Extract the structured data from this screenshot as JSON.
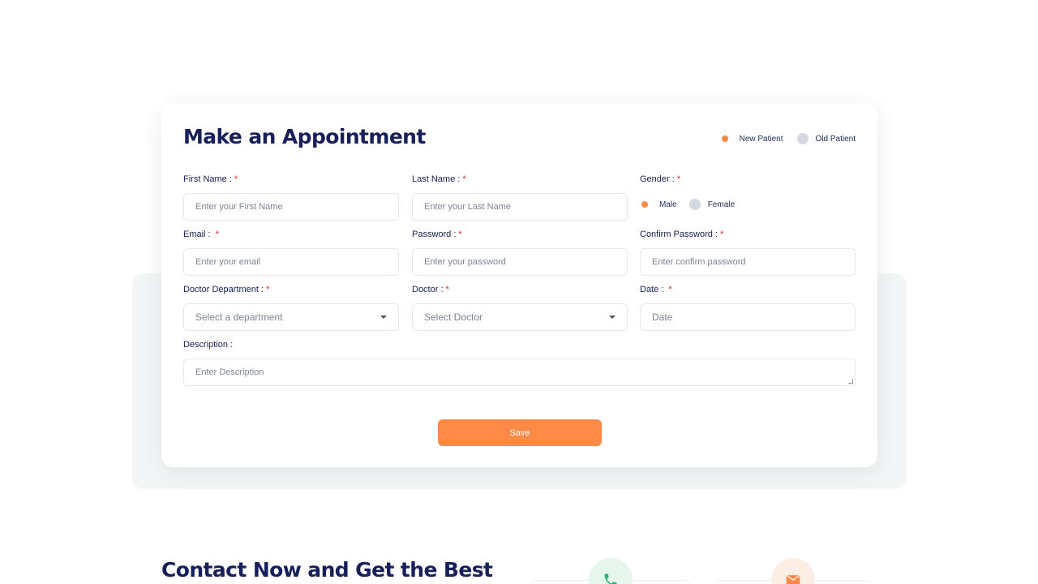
{
  "form": {
    "title": "Make an Appointment",
    "patient_type": {
      "options": [
        "New Patient",
        "Old Patient"
      ],
      "selected": "New Patient"
    },
    "first_name": {
      "label": "First Name :",
      "required": "*",
      "placeholder": "Enter your First Name"
    },
    "last_name": {
      "label": "Last Name :",
      "required": "*",
      "placeholder": "Enter your Last Name"
    },
    "gender": {
      "label": "Gender :",
      "required": "*",
      "options": [
        "Male",
        "Female"
      ],
      "selected": "Male"
    },
    "email": {
      "label": "Email :",
      "required": "*",
      "placeholder": "Enter your email"
    },
    "password": {
      "label": "Password :",
      "required": "*",
      "placeholder": "Enter your password"
    },
    "confirm_password": {
      "label": "Confirm Password :",
      "required": "*",
      "placeholder": "Enter confirm password"
    },
    "department": {
      "label": "Doctor Department :",
      "required": "*",
      "value": "Select a department"
    },
    "doctor": {
      "label": "Doctor :",
      "required": "*",
      "value": "Select Doctor"
    },
    "date": {
      "label": "Date :",
      "required": "*",
      "placeholder": "Date"
    },
    "description": {
      "label": "Description :",
      "placeholder": "Enter Description"
    },
    "save_label": "Save"
  },
  "contact": {
    "title": "Contact Now and Get the Best"
  },
  "icons": {
    "contact_phone": "phone-icon",
    "contact_email": "envelope-icon"
  },
  "colors": {
    "accent": "#fd8a47",
    "heading": "#17205a",
    "required": "#e21f1f",
    "panel_bg": "#f3f6f6",
    "phone_icon": "#2bb673"
  }
}
